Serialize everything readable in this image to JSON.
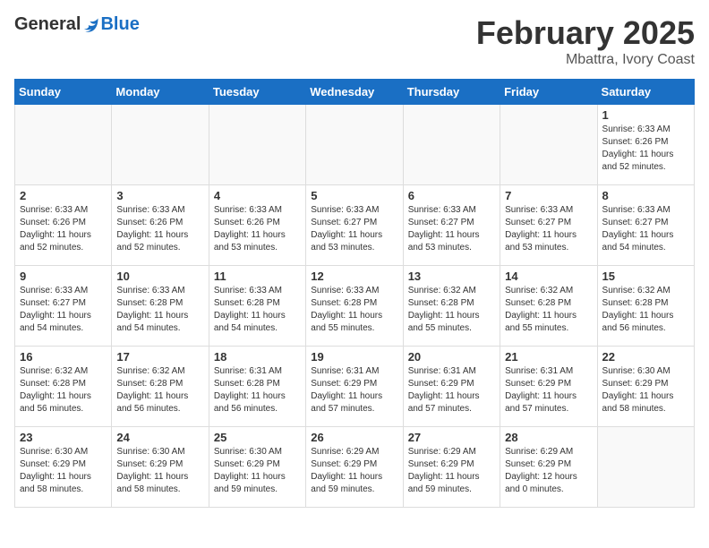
{
  "header": {
    "logo_general": "General",
    "logo_blue": "Blue",
    "title": "February 2025",
    "subtitle": "Mbattra, Ivory Coast"
  },
  "days_of_week": [
    "Sunday",
    "Monday",
    "Tuesday",
    "Wednesday",
    "Thursday",
    "Friday",
    "Saturday"
  ],
  "weeks": [
    [
      {
        "day": "",
        "info": ""
      },
      {
        "day": "",
        "info": ""
      },
      {
        "day": "",
        "info": ""
      },
      {
        "day": "",
        "info": ""
      },
      {
        "day": "",
        "info": ""
      },
      {
        "day": "",
        "info": ""
      },
      {
        "day": "1",
        "info": "Sunrise: 6:33 AM\nSunset: 6:26 PM\nDaylight: 11 hours\nand 52 minutes."
      }
    ],
    [
      {
        "day": "2",
        "info": "Sunrise: 6:33 AM\nSunset: 6:26 PM\nDaylight: 11 hours\nand 52 minutes."
      },
      {
        "day": "3",
        "info": "Sunrise: 6:33 AM\nSunset: 6:26 PM\nDaylight: 11 hours\nand 52 minutes."
      },
      {
        "day": "4",
        "info": "Sunrise: 6:33 AM\nSunset: 6:26 PM\nDaylight: 11 hours\nand 53 minutes."
      },
      {
        "day": "5",
        "info": "Sunrise: 6:33 AM\nSunset: 6:27 PM\nDaylight: 11 hours\nand 53 minutes."
      },
      {
        "day": "6",
        "info": "Sunrise: 6:33 AM\nSunset: 6:27 PM\nDaylight: 11 hours\nand 53 minutes."
      },
      {
        "day": "7",
        "info": "Sunrise: 6:33 AM\nSunset: 6:27 PM\nDaylight: 11 hours\nand 53 minutes."
      },
      {
        "day": "8",
        "info": "Sunrise: 6:33 AM\nSunset: 6:27 PM\nDaylight: 11 hours\nand 54 minutes."
      }
    ],
    [
      {
        "day": "9",
        "info": "Sunrise: 6:33 AM\nSunset: 6:27 PM\nDaylight: 11 hours\nand 54 minutes."
      },
      {
        "day": "10",
        "info": "Sunrise: 6:33 AM\nSunset: 6:28 PM\nDaylight: 11 hours\nand 54 minutes."
      },
      {
        "day": "11",
        "info": "Sunrise: 6:33 AM\nSunset: 6:28 PM\nDaylight: 11 hours\nand 54 minutes."
      },
      {
        "day": "12",
        "info": "Sunrise: 6:33 AM\nSunset: 6:28 PM\nDaylight: 11 hours\nand 55 minutes."
      },
      {
        "day": "13",
        "info": "Sunrise: 6:32 AM\nSunset: 6:28 PM\nDaylight: 11 hours\nand 55 minutes."
      },
      {
        "day": "14",
        "info": "Sunrise: 6:32 AM\nSunset: 6:28 PM\nDaylight: 11 hours\nand 55 minutes."
      },
      {
        "day": "15",
        "info": "Sunrise: 6:32 AM\nSunset: 6:28 PM\nDaylight: 11 hours\nand 56 minutes."
      }
    ],
    [
      {
        "day": "16",
        "info": "Sunrise: 6:32 AM\nSunset: 6:28 PM\nDaylight: 11 hours\nand 56 minutes."
      },
      {
        "day": "17",
        "info": "Sunrise: 6:32 AM\nSunset: 6:28 PM\nDaylight: 11 hours\nand 56 minutes."
      },
      {
        "day": "18",
        "info": "Sunrise: 6:31 AM\nSunset: 6:28 PM\nDaylight: 11 hours\nand 56 minutes."
      },
      {
        "day": "19",
        "info": "Sunrise: 6:31 AM\nSunset: 6:29 PM\nDaylight: 11 hours\nand 57 minutes."
      },
      {
        "day": "20",
        "info": "Sunrise: 6:31 AM\nSunset: 6:29 PM\nDaylight: 11 hours\nand 57 minutes."
      },
      {
        "day": "21",
        "info": "Sunrise: 6:31 AM\nSunset: 6:29 PM\nDaylight: 11 hours\nand 57 minutes."
      },
      {
        "day": "22",
        "info": "Sunrise: 6:30 AM\nSunset: 6:29 PM\nDaylight: 11 hours\nand 58 minutes."
      }
    ],
    [
      {
        "day": "23",
        "info": "Sunrise: 6:30 AM\nSunset: 6:29 PM\nDaylight: 11 hours\nand 58 minutes."
      },
      {
        "day": "24",
        "info": "Sunrise: 6:30 AM\nSunset: 6:29 PM\nDaylight: 11 hours\nand 58 minutes."
      },
      {
        "day": "25",
        "info": "Sunrise: 6:30 AM\nSunset: 6:29 PM\nDaylight: 11 hours\nand 59 minutes."
      },
      {
        "day": "26",
        "info": "Sunrise: 6:29 AM\nSunset: 6:29 PM\nDaylight: 11 hours\nand 59 minutes."
      },
      {
        "day": "27",
        "info": "Sunrise: 6:29 AM\nSunset: 6:29 PM\nDaylight: 11 hours\nand 59 minutes."
      },
      {
        "day": "28",
        "info": "Sunrise: 6:29 AM\nSunset: 6:29 PM\nDaylight: 12 hours\nand 0 minutes."
      },
      {
        "day": "",
        "info": ""
      }
    ]
  ]
}
